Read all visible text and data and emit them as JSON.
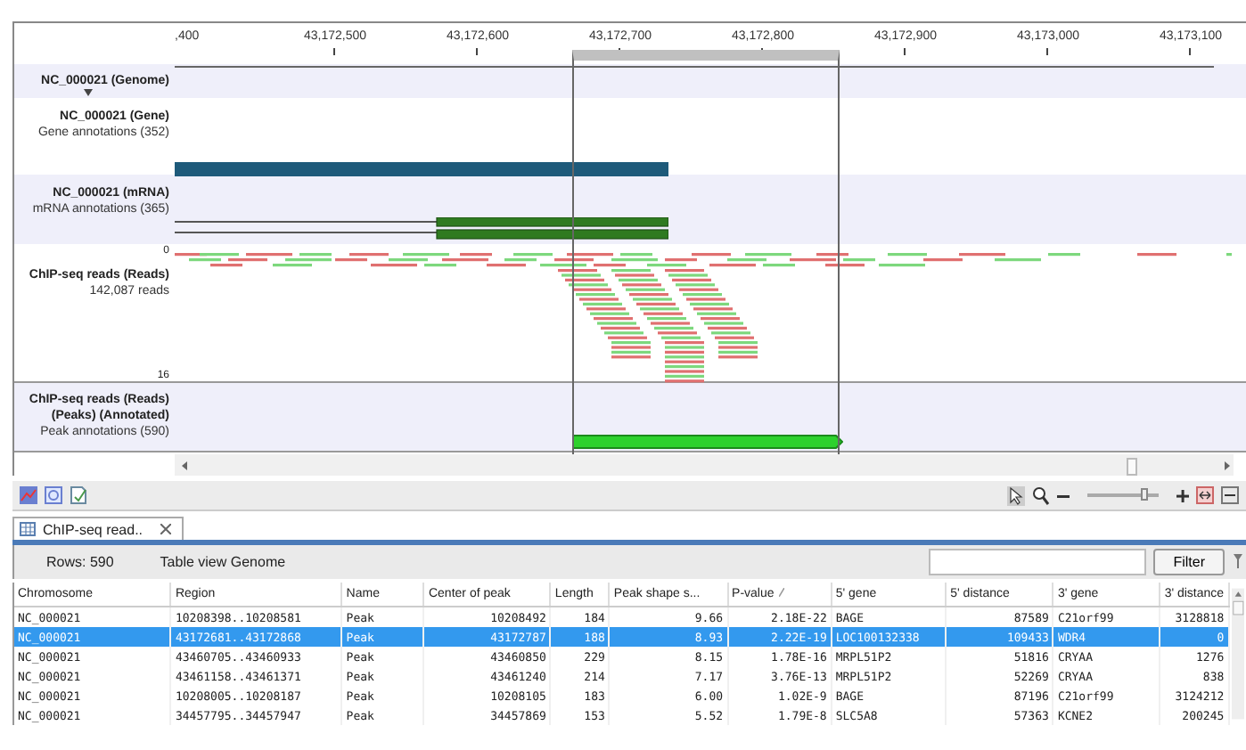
{
  "ruler": {
    "ticks": [
      ",400",
      "43,172,500",
      "43,172,600",
      "43,172,700",
      "43,172,800",
      "43,172,900",
      "43,173,000",
      "43,173,100"
    ]
  },
  "tracks": [
    {
      "kind": "genome",
      "title": "NC_000021 (Genome)"
    },
    {
      "kind": "gene",
      "title": "NC_000021 (Gene)",
      "subtitle": "Gene annotations (352)"
    },
    {
      "kind": "mrna",
      "title": "NC_000021 (mRNA)",
      "subtitle": "mRNA annotations (365)"
    },
    {
      "kind": "reads",
      "title": "ChIP-seq reads (Reads)",
      "subtitle": "142,087 reads",
      "scale_min": "0",
      "scale_max": "16"
    },
    {
      "kind": "peaks",
      "title": "ChIP-seq reads (Reads) (Peaks) (Annotated)",
      "subtitle": "Peak annotations (590)"
    }
  ],
  "zoom": {
    "level": 0.8
  },
  "tabs": [
    {
      "label": "ChIP-seq read..",
      "selected": true
    }
  ],
  "table": {
    "rows_count": "Rows: 590",
    "view_label": "Table view Genome",
    "filter_button": "Filter",
    "columns": [
      {
        "label": "Chromosome",
        "kind": "text"
      },
      {
        "label": "Region",
        "kind": "text"
      },
      {
        "label": "Name",
        "kind": "text"
      },
      {
        "label": "Center of peak",
        "kind": "number"
      },
      {
        "label": "Length",
        "kind": "number"
      },
      {
        "label": "Peak shape s...",
        "kind": "number"
      },
      {
        "label": "P-value",
        "kind": "number",
        "sorted": true
      },
      {
        "label": "5' gene",
        "kind": "text"
      },
      {
        "label": "5' distance",
        "kind": "number"
      },
      {
        "label": "3' gene",
        "kind": "text"
      },
      {
        "label": "3' distance",
        "kind": "number"
      }
    ],
    "rows": [
      {
        "selected": false,
        "cells": [
          "NC_000021",
          "10208398..10208581",
          "Peak",
          "10208492",
          "184",
          "9.66",
          "2.18E-22",
          "BAGE",
          "87589",
          "C21orf99",
          "3128818"
        ]
      },
      {
        "selected": true,
        "cells": [
          "NC_000021",
          "43172681..43172868",
          "Peak",
          "43172787",
          "188",
          "8.93",
          "2.22E-19",
          "LOC100132338",
          "109433",
          "WDR4",
          "0"
        ]
      },
      {
        "selected": false,
        "cells": [
          "NC_000021",
          "43460705..43460933",
          "Peak",
          "43460850",
          "229",
          "8.15",
          "1.78E-16",
          "MRPL51P2",
          "51816",
          "CRYAA",
          "1276"
        ]
      },
      {
        "selected": false,
        "cells": [
          "NC_000021",
          "43461158..43461371",
          "Peak",
          "43461240",
          "214",
          "7.17",
          "3.76E-13",
          "MRPL51P2",
          "52269",
          "CRYAA",
          "838"
        ]
      },
      {
        "selected": false,
        "cells": [
          "NC_000021",
          "10208005..10208187",
          "Peak",
          "10208105",
          "183",
          "6.00",
          "1.02E-9",
          "BAGE",
          "87196",
          "C21orf99",
          "3124212"
        ]
      },
      {
        "selected": false,
        "cells": [
          "NC_000021",
          "34457795..34457947",
          "Peak",
          "34457869",
          "153",
          "5.52",
          "1.79E-8",
          "SLC5A8",
          "57363",
          "KCNE2",
          "200245"
        ]
      }
    ]
  }
}
